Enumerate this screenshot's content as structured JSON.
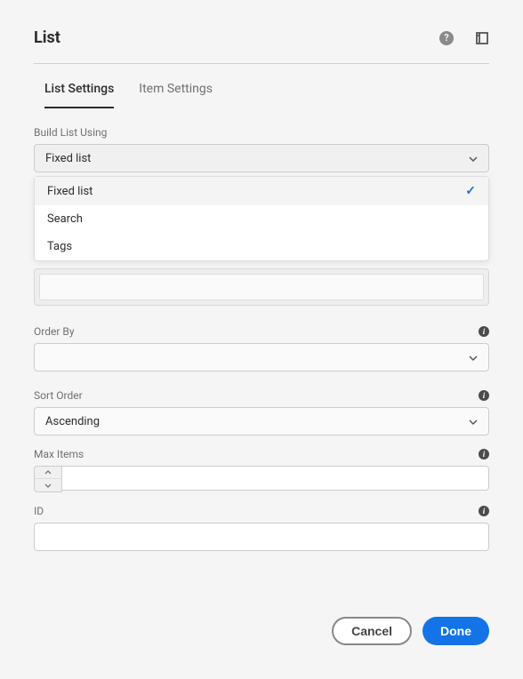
{
  "title": "List",
  "tabs": [
    {
      "label": "List Settings",
      "active": true
    },
    {
      "label": "Item Settings",
      "active": false
    }
  ],
  "fields": {
    "buildList": {
      "label": "Build List Using",
      "value": "Fixed list",
      "options": [
        {
          "label": "Fixed list",
          "selected": true
        },
        {
          "label": "Search",
          "selected": false
        },
        {
          "label": "Tags",
          "selected": false
        }
      ]
    },
    "orderBy": {
      "label": "Order By",
      "value": ""
    },
    "sortOrder": {
      "label": "Sort Order",
      "value": "Ascending"
    },
    "maxItems": {
      "label": "Max Items",
      "value": ""
    },
    "id": {
      "label": "ID",
      "value": ""
    }
  },
  "buttons": {
    "cancel": "Cancel",
    "done": "Done"
  }
}
